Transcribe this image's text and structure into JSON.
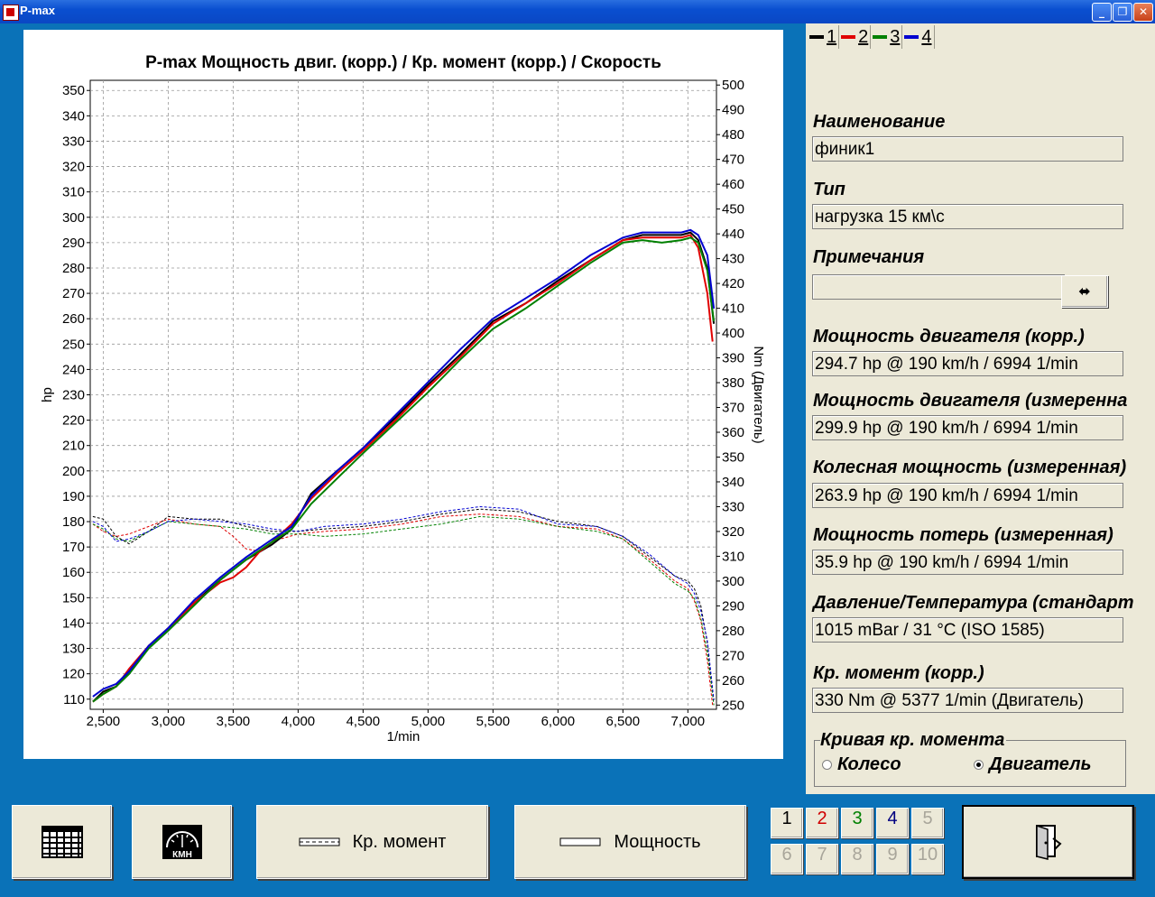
{
  "window": {
    "title": "P-max"
  },
  "tabs": [
    {
      "label": "1",
      "color": "#000000"
    },
    {
      "label": "2",
      "color": "#e00000"
    },
    {
      "label": "3",
      "color": "#008000"
    },
    {
      "label": "4",
      "color": "#0000d0"
    }
  ],
  "fields": {
    "name_label": "Наименование",
    "name_value": "финик1",
    "type_label": "Тип",
    "type_value": "нагрузка 15 км\\с",
    "notes_label": "Примечания",
    "notes_value": "",
    "power_corr_label": "Мощность двигателя (корр.)",
    "power_corr_value": "294.7 hp @ 190 km/h / 6994 1/min",
    "power_meas_label": "Мощность двигателя (измеренна",
    "power_meas_value": "299.9 hp @ 190 km/h / 6994 1/min",
    "wheel_label": "Колесная мощность (измеренная)",
    "wheel_value": "263.9 hp @ 190 km/h / 6994 1/min",
    "loss_label": "Мощность потерь (измеренная)",
    "loss_value": "35.9 hp @ 190 km/h / 6994 1/min",
    "press_label": "Давление/Температура (стандарт",
    "press_value": "1015 mBar / 31 °C (ISO 1585)",
    "torque_label": "Кр. момент (корр.)",
    "torque_value": "330 Nm @ 5377 1/min (Двигатель)"
  },
  "torque_curve": {
    "legend": "Кривая кр. момента",
    "option_wheel": "Колесо",
    "option_engine": "Двигатель",
    "selected": "Двигатель"
  },
  "buttons": {
    "torque": "Кр. момент",
    "power": "Мощность",
    "kmh_icon_text": "КМН"
  },
  "number_buttons": [
    {
      "label": "1",
      "color": "#000000",
      "enabled": true
    },
    {
      "label": "2",
      "color": "#d00000",
      "enabled": true
    },
    {
      "label": "3",
      "color": "#008000",
      "enabled": true
    },
    {
      "label": "4",
      "color": "#000080",
      "enabled": true
    },
    {
      "label": "5",
      "enabled": false
    },
    {
      "label": "6",
      "enabled": false
    },
    {
      "label": "7",
      "enabled": false
    },
    {
      "label": "8",
      "enabled": false
    },
    {
      "label": "9",
      "enabled": false
    },
    {
      "label": "10",
      "enabled": false
    }
  ],
  "chart_data": {
    "type": "line",
    "title": "P-max Мощность двиг. (корр.) / Кр. момент (корр.) / Скорость",
    "xlabel": "1/min",
    "ylabel": "hp",
    "y2label": "Nm (Двигатель)",
    "xlim": [
      2400,
      7220
    ],
    "ylim": [
      106,
      354
    ],
    "y2lim": [
      248.3,
      501.9
    ],
    "xticks": [
      "2,500",
      "3,000",
      "3,500",
      "4,000",
      "4,500",
      "5,000",
      "5,500",
      "6,000",
      "6,500",
      "7,000"
    ],
    "yticks": [
      110,
      120,
      130,
      140,
      150,
      160,
      170,
      180,
      190,
      200,
      210,
      220,
      230,
      240,
      250,
      260,
      270,
      280,
      290,
      300,
      310,
      320,
      330,
      340,
      350
    ],
    "y2ticks": [
      250,
      260,
      270,
      280,
      290,
      300,
      310,
      320,
      330,
      340,
      350,
      360,
      370,
      380,
      390,
      400,
      410,
      420,
      430,
      440,
      450,
      460,
      470,
      480,
      490,
      500
    ],
    "grid": true,
    "power_series": [
      {
        "name": "1",
        "color": "#000000",
        "x": [
          2420,
          2500,
          2600,
          2700,
          2850,
          3000,
          3200,
          3400,
          3600,
          3800,
          3950,
          4100,
          4300,
          4500,
          4750,
          5000,
          5250,
          5500,
          5750,
          6000,
          6250,
          6500,
          6650,
          6800,
          6950,
          7020,
          7080,
          7150,
          7200
        ],
        "y": [
          109,
          113,
          115,
          121,
          131,
          138,
          148,
          157,
          165,
          171,
          177,
          191,
          200,
          209,
          221,
          234,
          246,
          259,
          266,
          275,
          283,
          291,
          293,
          293,
          293,
          294,
          291,
          280,
          258
        ]
      },
      {
        "name": "2",
        "color": "#e00000",
        "x": [
          2420,
          2500,
          2600,
          2700,
          2850,
          3000,
          3200,
          3400,
          3500,
          3600,
          3700,
          3800,
          3950,
          4100,
          4300,
          4500,
          4750,
          5000,
          5250,
          5500,
          5750,
          6000,
          6250,
          6500,
          6650,
          6800,
          6950,
          7020,
          7080,
          7150,
          7190
        ],
        "y": [
          109,
          112,
          115,
          122,
          131,
          138,
          148,
          156,
          158,
          162,
          168,
          172,
          179,
          189,
          199,
          208,
          220,
          233,
          245,
          258,
          266,
          274,
          283,
          291,
          292,
          292,
          292,
          293,
          288,
          270,
          251
        ]
      },
      {
        "name": "3",
        "color": "#008000",
        "x": [
          2420,
          2500,
          2600,
          2700,
          2850,
          3000,
          3200,
          3400,
          3600,
          3800,
          3950,
          4100,
          4300,
          4500,
          4750,
          5000,
          5250,
          5500,
          5750,
          6000,
          6250,
          6500,
          6650,
          6800,
          6950,
          7020,
          7080,
          7150,
          7200
        ],
        "y": [
          109,
          112,
          115,
          120,
          130,
          137,
          147,
          157,
          165,
          172,
          177,
          187,
          197,
          207,
          219,
          231,
          244,
          256,
          264,
          273,
          282,
          290,
          291,
          290,
          291,
          292,
          290,
          279,
          259
        ]
      },
      {
        "name": "4",
        "color": "#0000d0",
        "x": [
          2420,
          2500,
          2600,
          2700,
          2850,
          3000,
          3200,
          3400,
          3600,
          3800,
          3950,
          4100,
          4300,
          4500,
          4750,
          5000,
          5250,
          5500,
          5750,
          6000,
          6250,
          6500,
          6650,
          6800,
          6950,
          7020,
          7080,
          7150,
          7200
        ],
        "y": [
          111,
          114,
          116,
          121,
          131,
          138,
          149,
          158,
          166,
          173,
          178,
          190,
          200,
          209,
          222,
          235,
          248,
          260,
          268,
          276,
          285,
          292,
          294,
          294,
          294,
          295,
          293,
          285,
          264
        ]
      }
    ],
    "torque_series": [
      {
        "name": "1",
        "color": "#000000",
        "x": [
          2420,
          2500,
          2600,
          2700,
          2850,
          3000,
          3200,
          3400,
          3600,
          3800,
          4000,
          4200,
          4500,
          4800,
          5100,
          5400,
          5700,
          6000,
          6300,
          6500,
          6700,
          6900,
          7000,
          7050,
          7100,
          7150,
          7200
        ],
        "y": [
          326,
          325,
          318,
          315,
          320,
          326,
          325,
          325,
          322,
          320,
          320,
          321,
          322,
          324,
          327,
          329,
          328,
          324,
          322,
          318,
          310,
          302,
          300,
          297,
          290,
          275,
          250
        ]
      },
      {
        "name": "2",
        "color": "#e00000",
        "x": [
          2420,
          2500,
          2600,
          2700,
          2850,
          3000,
          3200,
          3400,
          3500,
          3600,
          3700,
          3800,
          4000,
          4200,
          4500,
          4800,
          5100,
          5400,
          5700,
          6000,
          6300,
          6500,
          6700,
          6900,
          7000,
          7050,
          7100,
          7150,
          7190
        ],
        "y": [
          323,
          320,
          318,
          319,
          322,
          325,
          323,
          322,
          318,
          313,
          312,
          316,
          319,
          320,
          321,
          323,
          326,
          327,
          326,
          322,
          321,
          317,
          309,
          300,
          297,
          292,
          284,
          268,
          250
        ]
      },
      {
        "name": "3",
        "color": "#008000",
        "x": [
          2420,
          2500,
          2600,
          2700,
          2850,
          3000,
          3200,
          3400,
          3600,
          3800,
          4000,
          4200,
          4500,
          4800,
          5100,
          5400,
          5700,
          6000,
          6300,
          6500,
          6700,
          6900,
          7000,
          7050,
          7100,
          7150,
          7200
        ],
        "y": [
          323,
          321,
          317,
          316,
          320,
          324,
          323,
          322,
          321,
          319,
          319,
          318,
          319,
          321,
          323,
          326,
          325,
          322,
          320,
          317,
          308,
          299,
          296,
          293,
          285,
          271,
          250
        ]
      },
      {
        "name": "4",
        "color": "#0000d0",
        "x": [
          2420,
          2500,
          2600,
          2700,
          2850,
          3000,
          3200,
          3400,
          3600,
          3800,
          4000,
          4200,
          4500,
          4800,
          5100,
          5400,
          5700,
          6000,
          6300,
          6500,
          6700,
          6900,
          7000,
          7050,
          7100,
          7150,
          7200
        ],
        "y": [
          324,
          322,
          316,
          317,
          320,
          324,
          325,
          324,
          323,
          321,
          320,
          322,
          323,
          325,
          328,
          330,
          329,
          323,
          322,
          318,
          311,
          302,
          299,
          295,
          288,
          276,
          252
        ]
      }
    ]
  }
}
